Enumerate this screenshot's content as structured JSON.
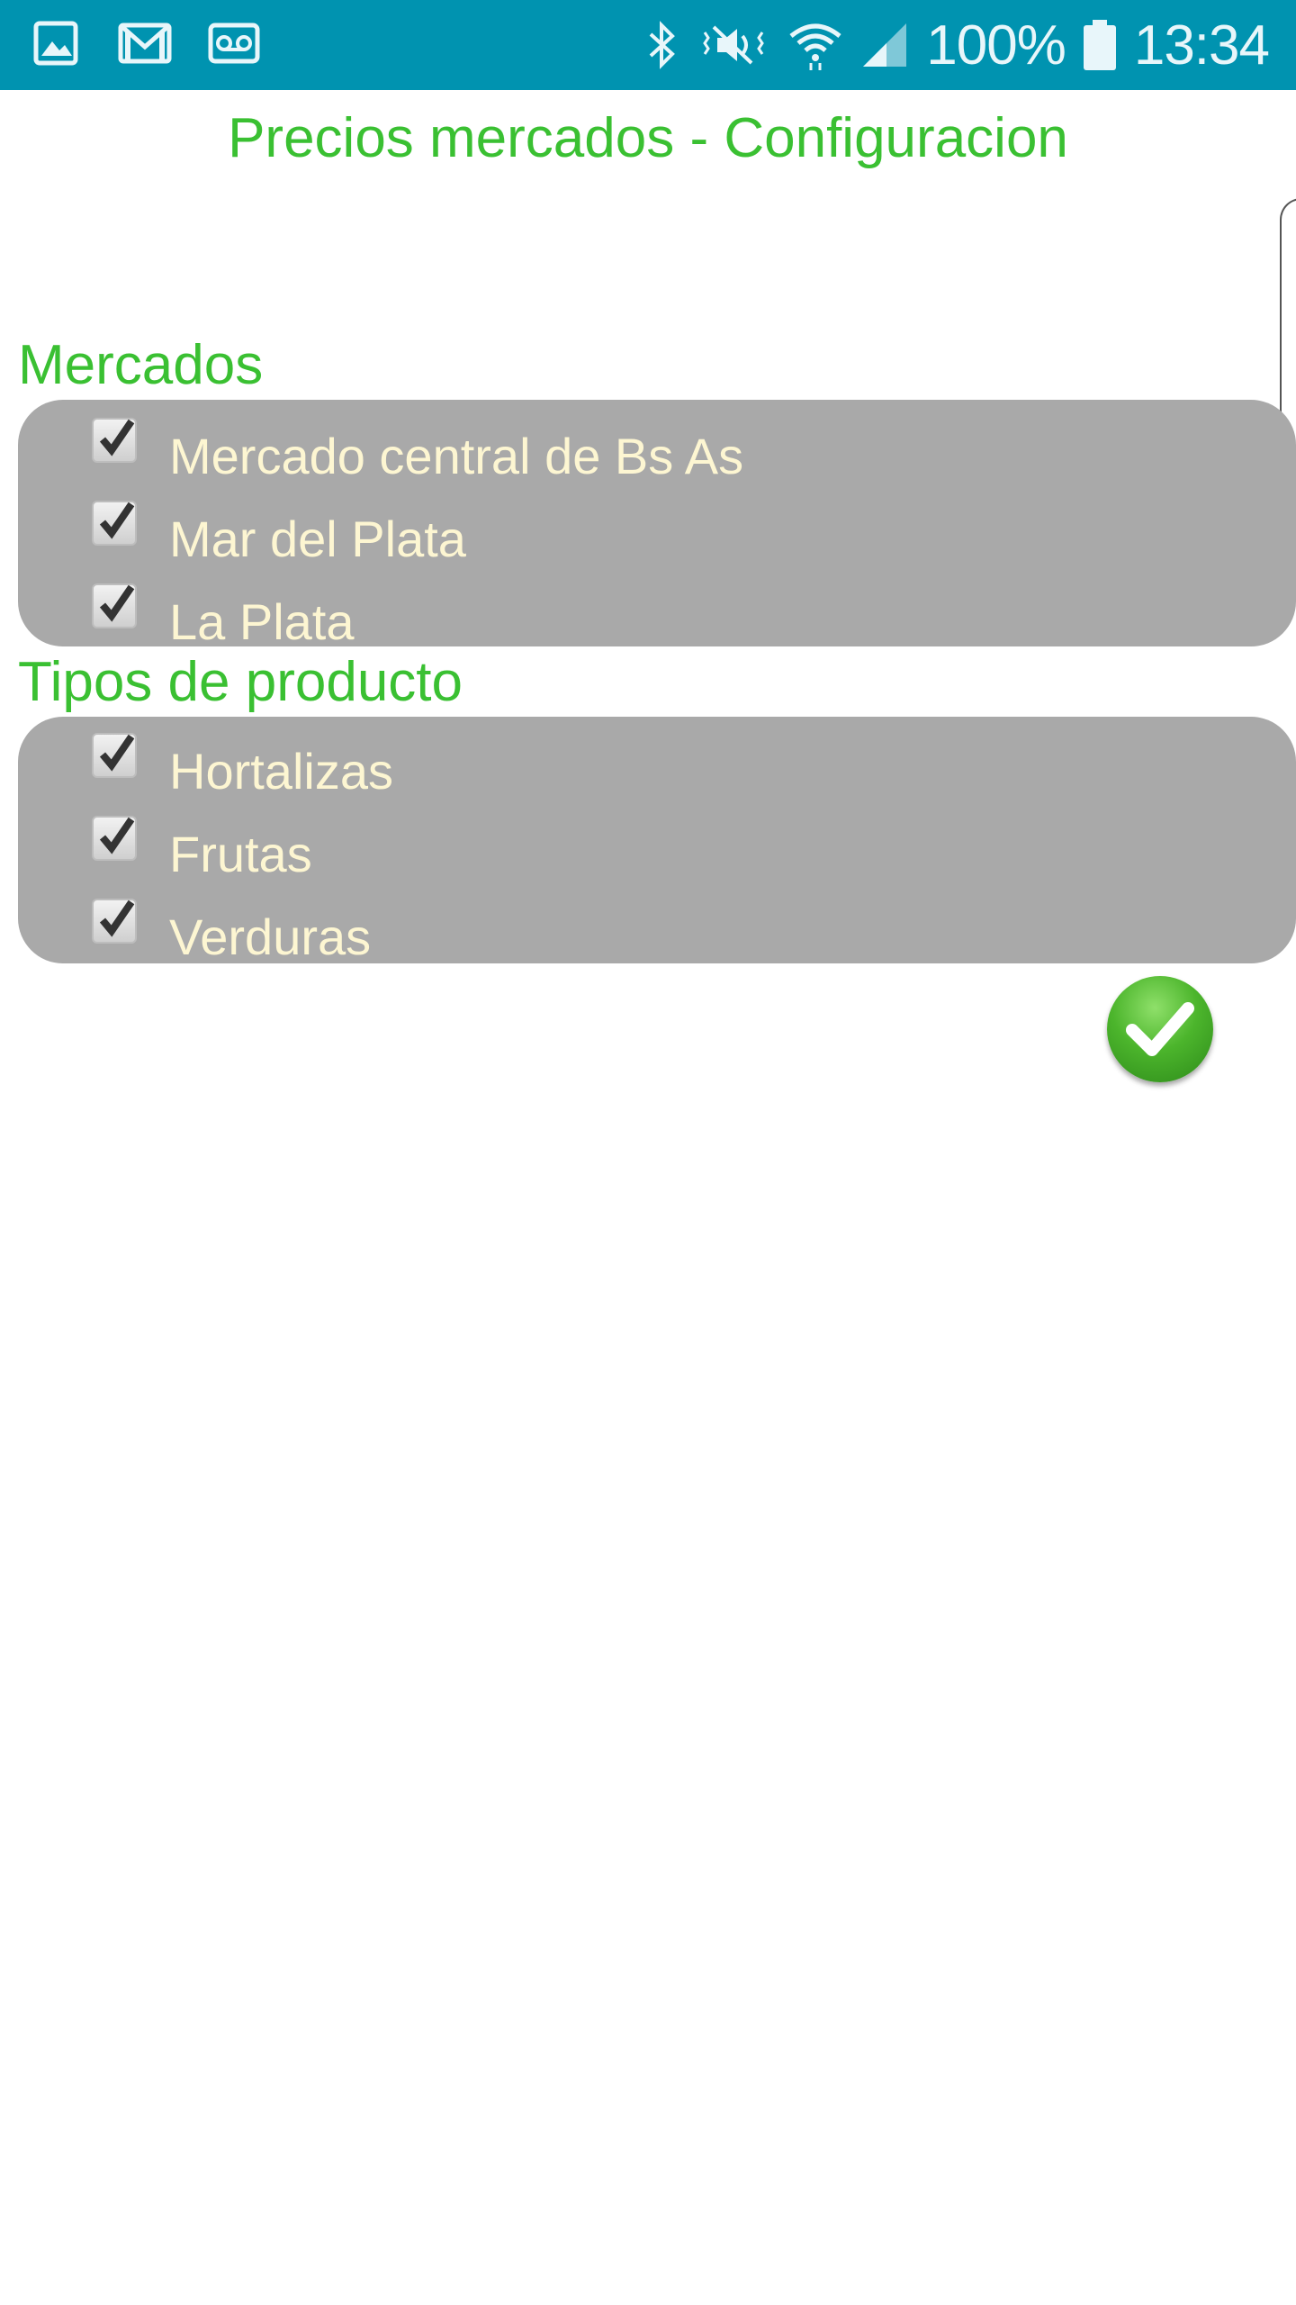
{
  "status_bar": {
    "left_icons": [
      "gallery-icon",
      "gmail-icon",
      "voicemail-icon"
    ],
    "right_icons": [
      "bluetooth-icon",
      "vibrate-mute-icon",
      "wifi-icon",
      "cell-signal-icon"
    ],
    "battery_percent": "100%",
    "time": "13:34",
    "background_color": "#0093b0"
  },
  "header": {
    "title": "Precios mercados - Configuracion"
  },
  "mercados": {
    "label": "Mercados",
    "items": [
      {
        "label": "Mercado central de Bs As",
        "checked": true
      },
      {
        "label": "Mar del Plata",
        "checked": true
      },
      {
        "label": "La Plata",
        "checked": true
      }
    ]
  },
  "tipos": {
    "label": "Tipos de producto",
    "items": [
      {
        "label": "Hortalizas",
        "checked": true
      },
      {
        "label": "Frutas",
        "checked": true
      },
      {
        "label": "Verduras",
        "checked": true
      }
    ]
  },
  "colors": {
    "accent_green": "#3ac032",
    "group_background": "#a9a9a9",
    "item_text": "#fdf6d2"
  },
  "actions": {
    "confirm_icon": "check-circle-icon"
  }
}
